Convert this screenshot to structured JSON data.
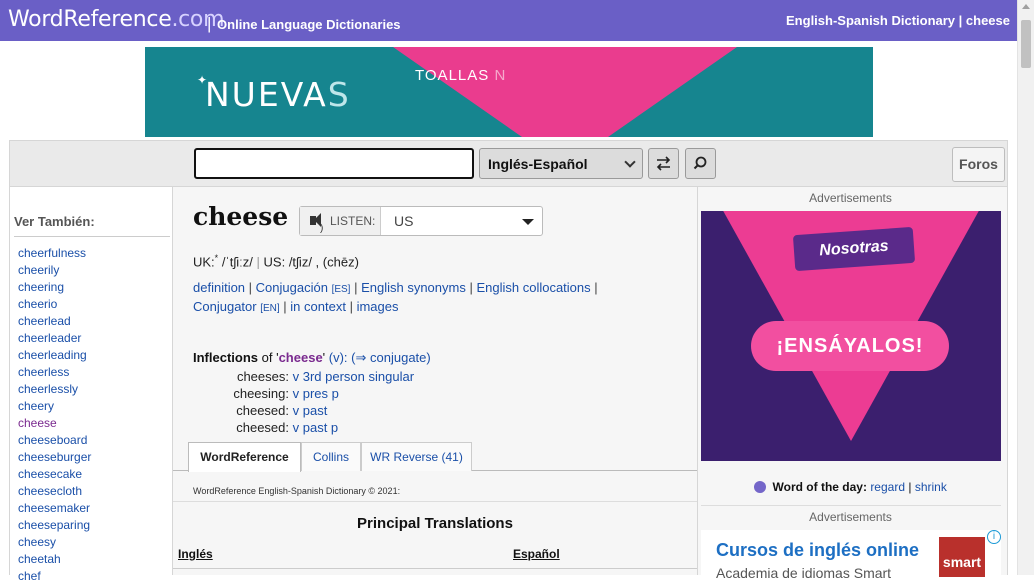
{
  "header": {
    "logo_main": "WordReference",
    "logo_dom": ".com",
    "pipe": "|",
    "subtitle": "Online Language Dictionaries",
    "right_title": "English-Spanish Dictionary | cheese",
    "brand_color": "#6a5fc6"
  },
  "banner_ad": {
    "word1_a": "NUEVA",
    "word1_b": "S",
    "word2_a": "TOALLAS",
    "word2_b": "N"
  },
  "search": {
    "input_value": "",
    "language": "Inglés-Español",
    "forums_label": "Foros"
  },
  "sidebar": {
    "title": "Ver También:",
    "items": [
      {
        "label": "cheerfulness"
      },
      {
        "label": "cheerily"
      },
      {
        "label": "cheering"
      },
      {
        "label": "cheerio"
      },
      {
        "label": "cheerlead"
      },
      {
        "label": "cheerleader"
      },
      {
        "label": "cheerleading"
      },
      {
        "label": "cheerless"
      },
      {
        "label": "cheerlessly"
      },
      {
        "label": "cheery"
      },
      {
        "label": "cheese"
      },
      {
        "label": "cheeseboard"
      },
      {
        "label": "cheeseburger"
      },
      {
        "label": "cheesecake"
      },
      {
        "label": "cheesecloth"
      },
      {
        "label": "cheesemaker"
      },
      {
        "label": "cheeseparing"
      },
      {
        "label": "cheesy"
      },
      {
        "label": "cheetah"
      },
      {
        "label": "chef"
      }
    ]
  },
  "entry": {
    "headword": "cheese",
    "listen_label": "LISTEN:",
    "accent": "US",
    "pron_uk_label": "UK:",
    "pron_uk_star": "*",
    "pron_uk": "/ˈtʃiːz/",
    "pron_us_label": "US:",
    "pron_us": "/tʃiz/",
    "pron_alt": "(chēz)",
    "links": {
      "definition": "definition",
      "conjugacion": "Conjugación",
      "conjugacion_tag": "[ES]",
      "synonyms": "English synonyms",
      "collocations": "English collocations",
      "conjugator": "Conjugator",
      "conjugator_tag": "[EN]",
      "context": "in context",
      "images": "images"
    },
    "inflections": {
      "label": "Inflections",
      "of": "of",
      "word": "cheese",
      "pos": "(v):",
      "conjugate": "(⇒ conjugate)",
      "rows": [
        {
          "form": "cheeses:",
          "desc": "v 3rd person singular"
        },
        {
          "form": "cheesing:",
          "desc": "v pres p"
        },
        {
          "form": "cheesed:",
          "desc": "v past"
        },
        {
          "form": "cheesed:",
          "desc": "v past p"
        }
      ]
    },
    "tabs": [
      {
        "label": "WordReference"
      },
      {
        "label": "Collins"
      },
      {
        "label": "WR Reverse (41)"
      }
    ],
    "dict_note": "WordReference English-Spanish Dictionary © 2021:",
    "principal_title": "Principal Translations",
    "col_en": "Inglés",
    "col_es": "Español"
  },
  "right": {
    "ads_label": "Advertisements",
    "ad_logo": "Nosotras",
    "ad_cta": "¡ENSÁYALOS!",
    "wotd_label": "Word of the day:",
    "wotd_1": "regard",
    "wotd_sep": "|",
    "wotd_2": "shrink",
    "ad2_title": "Cursos de inglés online",
    "ad2_sub": "Academia de idiomas Smart",
    "ad2_logo": "smart",
    "ad2_info": "i"
  }
}
